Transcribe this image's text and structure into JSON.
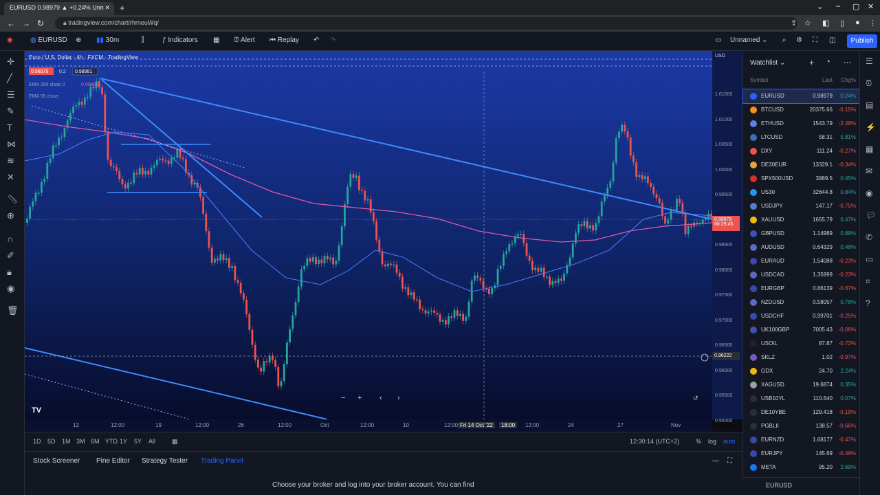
{
  "browser": {
    "tab_title": "EURUSD 0.98979 ▲ +0.24% Unn",
    "url": "tradingview.com/chart/rhrneuWq/"
  },
  "toolbar": {
    "symbol": "EURUSD",
    "interval": "30m",
    "indicators": "Indicators",
    "alert": "Alert",
    "replay": "Replay",
    "layout_name": "Unnamed",
    "publish": "Publish"
  },
  "legend": {
    "title": "Euro / U.S. Dollar · 4h · FXCM · TradingView",
    "bid": "0.98979",
    "spread": "0.2",
    "ask": "0.98981",
    "ema1": "EMA 200 close 0",
    "ema1_value": "0.98889",
    "ema2": "EMA 55 close"
  },
  "chart_data": {
    "type": "candlestick",
    "symbol": "EURUSD",
    "price_ticks": [
      "1.01500",
      "1.01000",
      "1.00500",
      "1.00000",
      "0.99500",
      "0.99000",
      "0.98500",
      "0.98000",
      "0.97500",
      "0.97000",
      "0.96500",
      "0.96000",
      "0.95500",
      "0.95000"
    ],
    "time_ticks": [
      "12",
      "12:00",
      "19",
      "12:00",
      "26",
      "12:00",
      "Oct",
      "12:00",
      "10",
      "12:00",
      "Fri 14 Oct '22",
      "18:00",
      "12:00",
      "24",
      "27",
      "Nov"
    ],
    "current_price": "0.98979",
    "current_price_sub": "00:29:45",
    "crosshair_price": "0.96222",
    "top_label": "USD"
  },
  "range": {
    "items": [
      "1D",
      "5D",
      "1M",
      "3M",
      "6M",
      "YTD",
      "1Y",
      "5Y",
      "All"
    ],
    "clock": "12:30:14 (UTC+2)",
    "pct": "%",
    "log": "log",
    "auto": "auto"
  },
  "bottom": {
    "tabs": [
      "Stock Screener",
      "Pine Editor",
      "Strategy Tester",
      "Trading Panel"
    ],
    "message": "Choose your broker and log into your broker account. You can find"
  },
  "watchlist": {
    "title": "Watchlist",
    "col_symbol": "Symbol",
    "col_last": "Last",
    "col_chg": "Chg%",
    "footer_symbol": "EURUSD",
    "items": [
      {
        "symbol": "EURUSD",
        "last": "0.98979",
        "chg": "0.24%",
        "color": "#2962ff",
        "chgColor": "#26a69a"
      },
      {
        "symbol": "BTCUSD",
        "last": "20375.66",
        "chg": "-0.15%",
        "color": "#f7931a",
        "chgColor": "#ef5350"
      },
      {
        "symbol": "ETHUSD",
        "last": "1543.79",
        "chg": "-2.48%",
        "color": "#627eea",
        "chgColor": "#ef5350"
      },
      {
        "symbol": "LTCUSD",
        "last": "58.31",
        "chg": "5.81%",
        "color": "#3c6fb8",
        "chgColor": "#26a69a"
      },
      {
        "symbol": "DXY",
        "last": "111.24",
        "chg": "-0.27%",
        "color": "#ef5350",
        "chgColor": "#ef5350"
      },
      {
        "symbol": "DE30EUR",
        "last": "13329.1",
        "chg": "-0.34%",
        "color": "#e8a33a",
        "chgColor": "#ef5350"
      },
      {
        "symbol": "SPX500USD",
        "last": "3889.5",
        "chg": "0.45%",
        "color": "#d32f2f",
        "chgColor": "#26a69a"
      },
      {
        "symbol": "US30",
        "last": "32644.8",
        "chg": "0.84%",
        "color": "#2196f3",
        "chgColor": "#26a69a"
      },
      {
        "symbol": "USDJPY",
        "last": "147.17",
        "chg": "-0.75%",
        "color": "#5b7cc9",
        "chgColor": "#ef5350"
      },
      {
        "symbol": "XAUUSD",
        "last": "1655.79",
        "chg": "0.47%",
        "color": "#f0b90b",
        "chgColor": "#26a69a"
      },
      {
        "symbol": "GBPUSD",
        "last": "1.14989",
        "chg": "0.88%",
        "color": "#3f51b5",
        "chgColor": "#26a69a"
      },
      {
        "symbol": "AUDUSD",
        "last": "0.64329",
        "chg": "0.48%",
        "color": "#5c6bc0",
        "chgColor": "#26a69a"
      },
      {
        "symbol": "EURAUD",
        "last": "1.54088",
        "chg": "-0.23%",
        "color": "#3949ab",
        "chgColor": "#ef5350"
      },
      {
        "symbol": "USDCAD",
        "last": "1.35999",
        "chg": "-0.23%",
        "color": "#5c6bc0",
        "chgColor": "#ef5350"
      },
      {
        "symbol": "EURGBP",
        "last": "0.86139",
        "chg": "-0.67%",
        "color": "#3949ab",
        "chgColor": "#ef5350"
      },
      {
        "symbol": "NZDUSD",
        "last": "0.58057",
        "chg": "0.78%",
        "color": "#5c6bc0",
        "chgColor": "#26a69a"
      },
      {
        "symbol": "USDCHF",
        "last": "0.99701",
        "chg": "-0.25%",
        "color": "#3949ab",
        "chgColor": "#ef5350"
      },
      {
        "symbol": "UK100GBP",
        "last": "7005.43",
        "chg": "-0.06%",
        "color": "#3f51b5",
        "chgColor": "#ef5350"
      },
      {
        "symbol": "USOIL",
        "last": "87.87",
        "chg": "-0.72%",
        "color": "#222222",
        "chgColor": "#ef5350"
      },
      {
        "symbol": "SKLZ",
        "last": "1.02",
        "chg": "-0.97%",
        "color": "#7e57c2",
        "chgColor": "#ef5350"
      },
      {
        "symbol": "GDX",
        "last": "24.70",
        "chg": "2.24%",
        "color": "#f0b90b",
        "chgColor": "#26a69a"
      },
      {
        "symbol": "XAGUSD",
        "last": "19.6874",
        "chg": "0.35%",
        "color": "#9e9e9e",
        "chgColor": "#26a69a"
      },
      {
        "symbol": "USB10YL",
        "last": "110.640",
        "chg": "0.07%",
        "color": "#2a2e39",
        "chgColor": "#26a69a"
      },
      {
        "symbol": "DE10YBE",
        "last": "129.418",
        "chg": "-0.19%",
        "color": "#2a2e39",
        "chgColor": "#ef5350"
      },
      {
        "symbol": "PGBLII",
        "last": "138.57",
        "chg": "-0.66%",
        "color": "#2a2e39",
        "chgColor": "#ef5350"
      },
      {
        "symbol": "EURNZD",
        "last": "1.68177",
        "chg": "-0.47%",
        "color": "#3949ab",
        "chgColor": "#ef5350"
      },
      {
        "symbol": "EURJPY",
        "last": "145.69",
        "chg": "-0.49%",
        "color": "#3949ab",
        "chgColor": "#ef5350"
      },
      {
        "symbol": "META",
        "last": "95.20",
        "chg": "2.69%",
        "color": "#1877f2",
        "chgColor": "#26a69a"
      }
    ]
  }
}
